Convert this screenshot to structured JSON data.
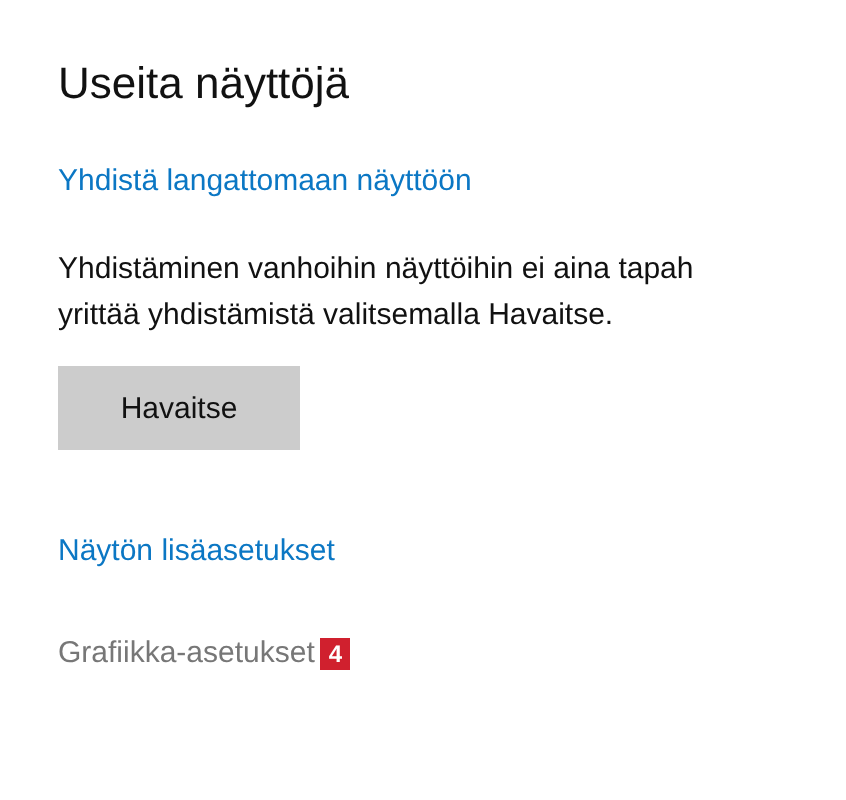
{
  "heading": "Useita näyttöjä",
  "wireless_link": "Yhdistä langattomaan näyttöön",
  "description_lines": [
    "Yhdistäminen vanhoihin näyttöihin ei aina tapah",
    "yrittää yhdistämistä valitsemalla Havaitse."
  ],
  "detect_button": "Havaitse",
  "links": [
    {
      "label": "Näytön lisäasetukset",
      "disabled": false
    },
    {
      "label": "Grafiikka-asetukset",
      "disabled": true,
      "badge": "4"
    }
  ]
}
